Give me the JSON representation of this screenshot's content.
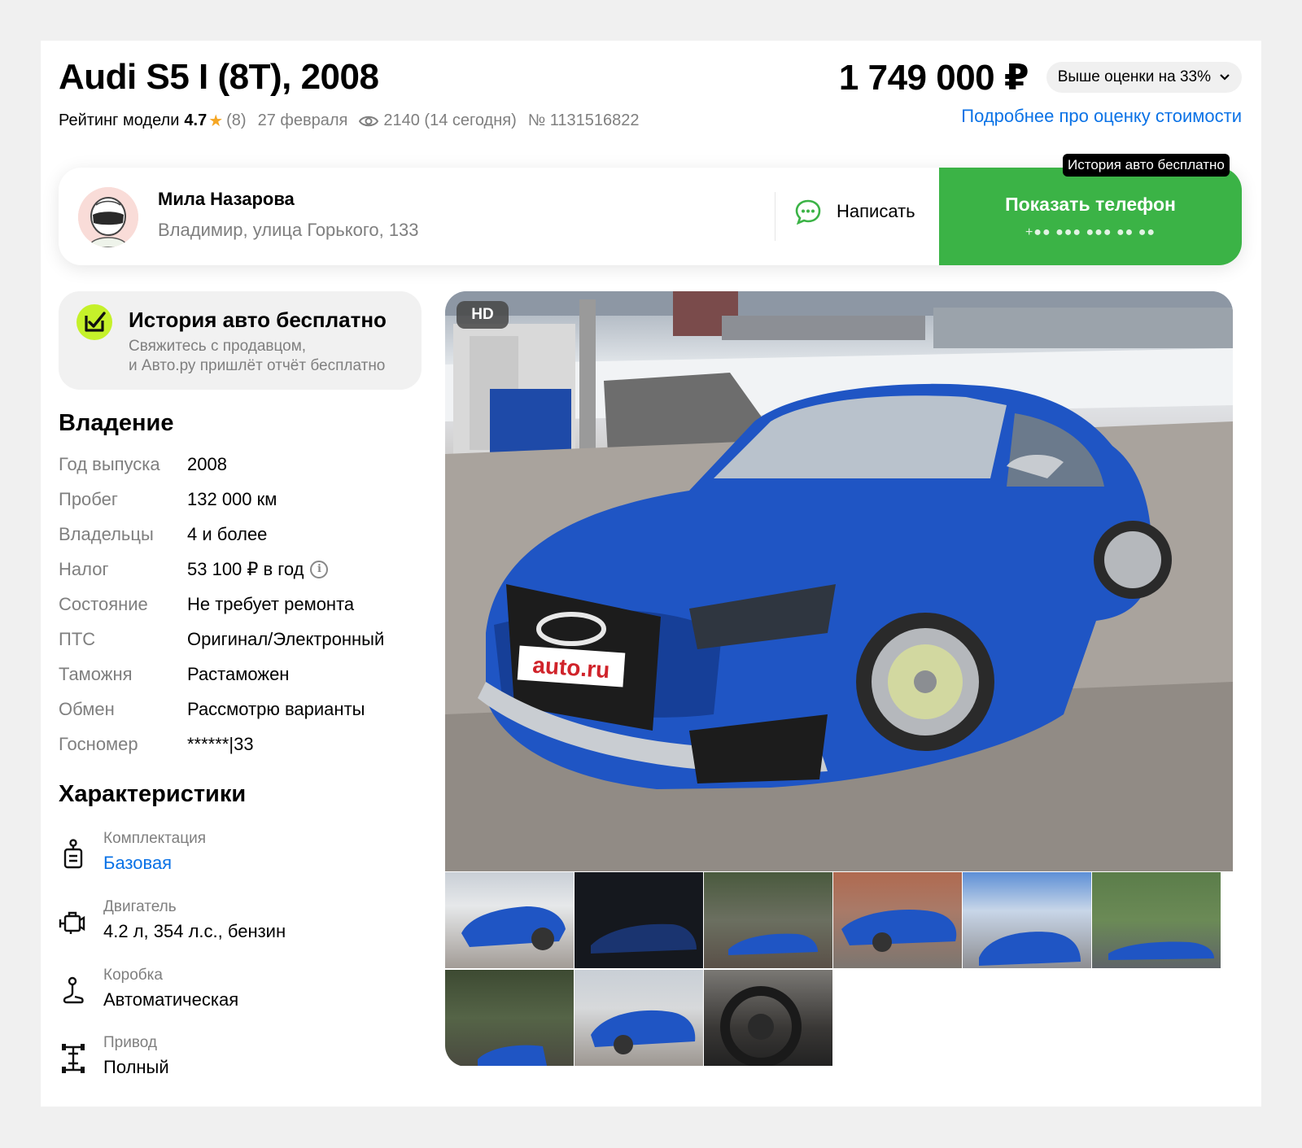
{
  "header": {
    "title": "Audi S5 I (8T), 2008",
    "rating_label": "Рейтинг модели",
    "rating_value": "4.7",
    "rating_star": "★",
    "reviews": "(8)",
    "date": "27 февраля",
    "views": "2140 (14 сегодня)",
    "listing_number": "№ 1131516822",
    "price": "1 749 000 ₽",
    "price_badge": "Выше оценки на 33%",
    "price_badge_chevron": "⌄",
    "estimate_link": "Подробнее про оценку стоимости"
  },
  "seller": {
    "name": "Мила Назарова",
    "address": "Владимир, улица Горького, 133",
    "write_label": "Написать",
    "phone_label": "Показать телефон",
    "phone_masked": "+●● ●●● ●●● ●● ●●",
    "tooltip": "История авто бесплатно"
  },
  "history_promo": {
    "title": "История авто бесплатно",
    "line1": "Свяжитесь с продавцом,",
    "line2": "и Авто.ру пришлёт отчёт бесплатно"
  },
  "ownership": {
    "heading": "Владение",
    "rows": [
      {
        "key": "Год выпуска",
        "value": "2008"
      },
      {
        "key": "Пробег",
        "value": "132 000 км"
      },
      {
        "key": "Владельцы",
        "value": "4 и более"
      },
      {
        "key": "Налог",
        "value": "53 100 ₽ в год"
      },
      {
        "key": "Состояние",
        "value": "Не требует ремонта"
      },
      {
        "key": "ПТС",
        "value": "Оригинал/Электронный"
      },
      {
        "key": "Таможня",
        "value": "Растаможен"
      },
      {
        "key": "Обмен",
        "value": "Рассмотрю варианты"
      },
      {
        "key": "Госномер",
        "value": "******|33"
      }
    ]
  },
  "specs": {
    "heading": "Характеристики",
    "items": [
      {
        "label": "Комплектация",
        "value": "Базовая",
        "icon": "trim-icon"
      },
      {
        "label": "Двигатель",
        "value": "4.2 л, 354 л.с., бензин",
        "icon": "engine-icon"
      },
      {
        "label": "Коробка",
        "value": "Автоматическая",
        "icon": "gearbox-icon"
      },
      {
        "label": "Привод",
        "value": "Полный",
        "icon": "drivetrain-icon"
      }
    ]
  },
  "gallery": {
    "badge": "HD",
    "plate_text": "auto.ru",
    "thumb_count": 9
  },
  "colors": {
    "accent_green": "#3bb346",
    "link_blue": "#0a72e6",
    "car_blue": "#1f55c4"
  }
}
